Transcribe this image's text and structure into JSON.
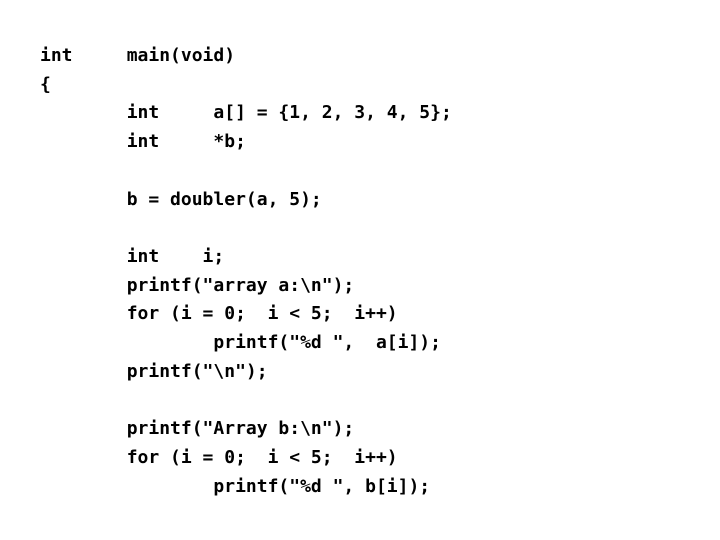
{
  "slide": {
    "background_color": "#ffffff",
    "text_color": "#000000",
    "language": "c",
    "code_lines": [
      "int     main(void)",
      "{",
      "        int     a[] = {1, 2, 3, 4, 5};",
      "        int     *b;",
      "",
      "        b = doubler(a, 5);",
      "",
      "        int    i;",
      "        printf(\"array a:\\n\");",
      "        for (i = 0;  i < 5;  i++)",
      "                printf(\"%d \",  a[i]);",
      "        printf(\"\\n\");",
      "",
      "        printf(\"Array b:\\n\");",
      "        for (i = 0;  i < 5;  i++)",
      "                printf(\"%d \", b[i]);"
    ]
  }
}
